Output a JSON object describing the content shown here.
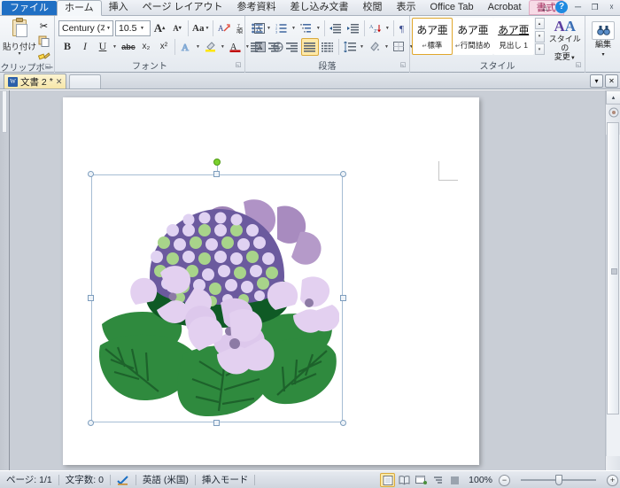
{
  "window": {
    "help_icon": "help-icon",
    "minimize": "−",
    "restore": "❐",
    "close": "✕",
    "ribbon_collapse": "⌃"
  },
  "ribbon_tabs": [
    {
      "label": "ファイル",
      "state": "file"
    },
    {
      "label": "ホーム",
      "state": "active"
    },
    {
      "label": "挿入",
      "state": "normal"
    },
    {
      "label": "ページ レイアウト",
      "state": "normal"
    },
    {
      "label": "参考資料",
      "state": "normal"
    },
    {
      "label": "差し込み文書",
      "state": "normal"
    },
    {
      "label": "校閲",
      "state": "normal"
    },
    {
      "label": "表示",
      "state": "normal"
    },
    {
      "label": "Office Tab",
      "state": "normal"
    },
    {
      "label": "Acrobat",
      "state": "normal"
    },
    {
      "label": "書式",
      "state": "contextual"
    }
  ],
  "groups": {
    "clipboard": {
      "label": "クリップボード",
      "paste_label": "貼り付け",
      "paste_arrow": "▾",
      "cut_icon": "scissors-icon",
      "copy_icon": "copy-icon",
      "format_painter_icon": "format-painter-icon",
      "dialog_launcher": "◱"
    },
    "font": {
      "label": "フォント",
      "font_name": "Century (本文",
      "font_size": "10.5",
      "grow_font": "A",
      "shrink_font": "A",
      "change_case": "Aa",
      "clear_formatting_icon": "clear-formatting-icon",
      "phonetic_guide_icon": "phonetic-guide-icon",
      "character_border_icon": "character-border-icon",
      "bold": "B",
      "italic": "I",
      "underline": "U",
      "strikethrough": "abc",
      "subscript": "x₂",
      "superscript": "x²",
      "text_effects_icon": "text-effects-icon",
      "highlight_icon": "text-highlight-icon",
      "font_color": "A",
      "character_shading_icon": "character-shading-icon",
      "enclose_characters_icon": "enclose-characters-icon",
      "dialog_launcher": "◱"
    },
    "paragraph": {
      "label": "段落",
      "bullets_icon": "bullet-list-icon",
      "numbering_icon": "numbered-list-icon",
      "multilevel_icon": "multilevel-list-icon",
      "decrease_indent_icon": "decrease-indent-icon",
      "increase_indent_icon": "increase-indent-icon",
      "sort_asc_icon": "sort-icon",
      "show_marks_icon": "show-formatting-marks-icon",
      "align_left_icon": "align-left-icon",
      "align_center_icon": "align-center-icon",
      "align_right_icon": "align-right-icon",
      "justify_icon": "justify-icon",
      "distribute_icon": "distribute-icon",
      "line_spacing_icon": "line-spacing-icon",
      "shading_icon": "shading-icon",
      "borders_icon": "borders-icon",
      "dialog_launcher": "◱"
    },
    "styles": {
      "label": "スタイル",
      "items": [
        {
          "preview": "あア亜",
          "name": "標準",
          "mark": "↵",
          "selected": true
        },
        {
          "preview": "あア亜",
          "name": "行間詰め",
          "mark": "↵",
          "selected": false
        },
        {
          "preview": "あア亜",
          "name": "見出し 1",
          "mark": "",
          "selected": false
        }
      ],
      "scroll_up": "▴",
      "scroll_down": "▾",
      "scroll_more": "▾",
      "change_styles_label_1": "スタイルの",
      "change_styles_label_2": "変更",
      "change_styles_icon": "change-styles-icon",
      "dialog_launcher": "◱"
    },
    "editing": {
      "label": "編集",
      "icon": "find-binoculars-icon",
      "arrow": "▾"
    }
  },
  "doc_tabs": {
    "tabs": [
      {
        "label": "文書 2",
        "modified": "*",
        "close": "✕",
        "icon": "word-document-icon"
      }
    ],
    "new_tab_tooltip": "new-tab",
    "menu_button": "▾",
    "close_button": "✕"
  },
  "document": {
    "page_number_indicator": "margin-marker",
    "selected_object": "hydrangea-clipart",
    "selection": {
      "rotation_handle": "rotate-handle",
      "handles": 8
    }
  },
  "status_bar": {
    "page_info": "ページ: 1/1",
    "word_count": "文字数: 0",
    "proofing_icon": "proofing-errors-icon",
    "language": "英語 (米国)",
    "insert_mode": "挿入モード",
    "views": [
      {
        "icon": "print-layout-icon",
        "name": "print-layout",
        "active": true
      },
      {
        "icon": "fullscreen-reading-icon",
        "name": "full-screen-reading",
        "active": false
      },
      {
        "icon": "web-layout-icon",
        "name": "web-layout",
        "active": false
      },
      {
        "icon": "outline-icon",
        "name": "outline",
        "active": false
      },
      {
        "icon": "draft-icon",
        "name": "draft",
        "active": false
      }
    ],
    "zoom_value": "100%",
    "zoom_out": "−",
    "zoom_in": "+"
  },
  "scrollbar": {
    "up_arrow": "▴",
    "down_arrow": "▾",
    "split_icon": "split-window-icon",
    "browse_icon": "select-browse-object-icon"
  },
  "colors": {
    "file_tab": "#1f6fc4",
    "contextual_tab": "#a0285a",
    "selection_border": "#a6bdd4",
    "rotate_handle": "#7ad12e",
    "highlight_orange": "#e0a72b",
    "petal_light": "#e3d0f0",
    "petal_mid": "#cdaade",
    "petal_dark": "#a88bbf",
    "floret_purple": "#6b5a9e",
    "floret_dot": "#e0d2f2",
    "floret_green": "#a8d48a",
    "leaf_green": "#2f8a3e",
    "leaf_dark": "#1d6b2c",
    "leaf_vein": "#1a5c28"
  }
}
